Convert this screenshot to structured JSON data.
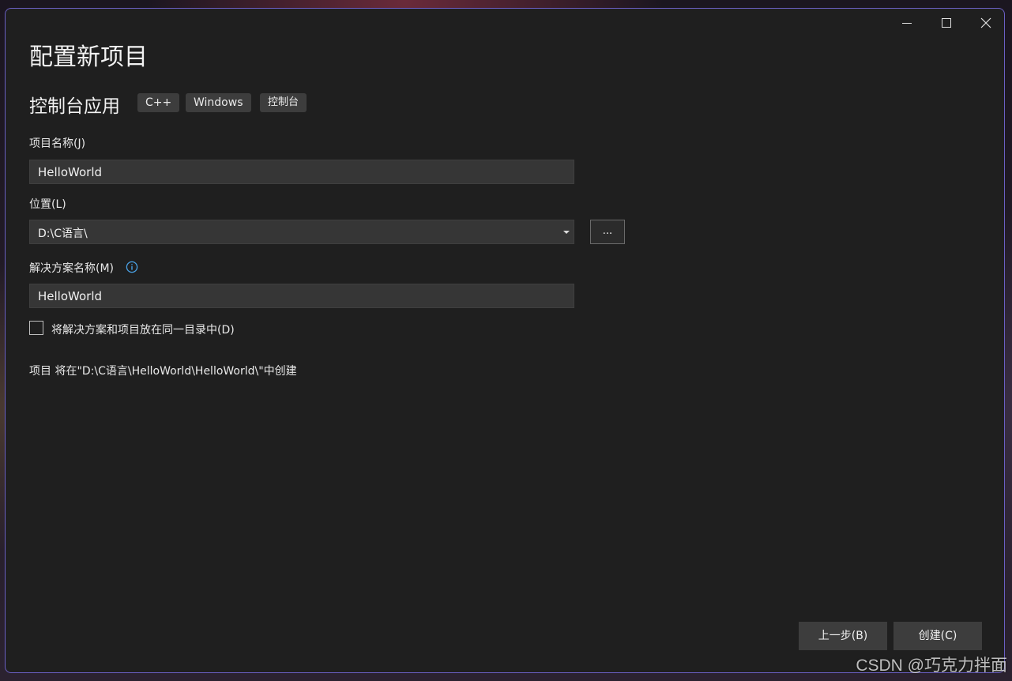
{
  "dialog": {
    "title": "配置新项目",
    "template_name": "控制台应用",
    "tags": [
      "C++",
      "Windows",
      "控制台"
    ]
  },
  "window_controls": {
    "minimize": "minimize-icon",
    "maximize": "maximize-icon",
    "close": "close-icon"
  },
  "form": {
    "project_name_label": "项目名称(J)",
    "project_name_value": "HelloWorld",
    "location_label": "位置(L)",
    "location_value": "D:\\C语言\\",
    "browse_label": "...",
    "solution_name_label": "解决方案名称(M)",
    "solution_name_value": "HelloWorld",
    "same_dir_checkbox_label": "将解决方案和项目放在同一目录中(D)",
    "same_dir_checked": false,
    "path_note": "项目 将在\"D:\\C语言\\HelloWorld\\HelloWorld\\\"中创建"
  },
  "footer": {
    "back_label": "上一步(B)",
    "create_label": "创建(C)"
  },
  "watermark": "CSDN @巧克力拌面",
  "colors": {
    "dialog_bg": "#1f1f1f",
    "border_accent": "#6a5fc4",
    "input_bg": "#363636",
    "button_bg": "#3d3d3d",
    "info_blue": "#4aa3e8"
  }
}
